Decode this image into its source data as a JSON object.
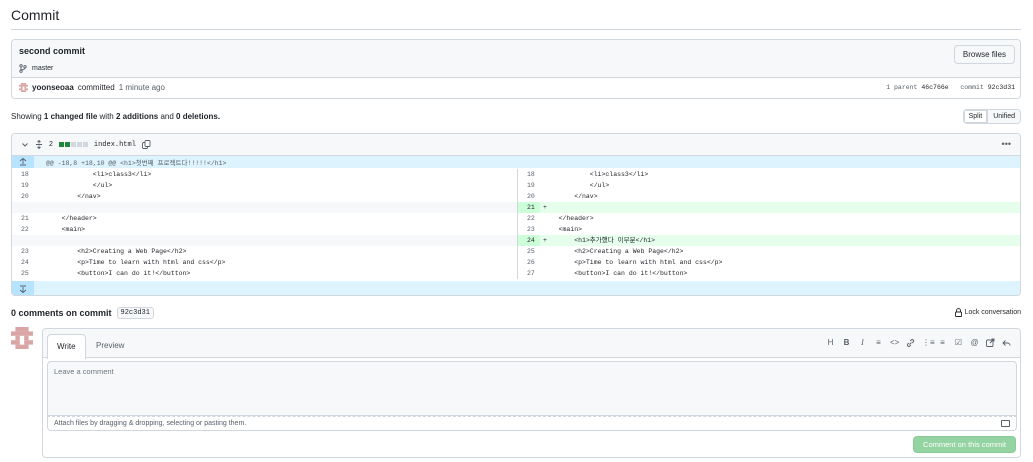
{
  "page": {
    "title": "Commit"
  },
  "commit": {
    "message": "second commit",
    "branch": "master",
    "browse_files_label": "Browse files",
    "author": "yoonseoaa",
    "action": "committed",
    "time": "1 minute ago",
    "parent_count": "1 parent",
    "parent_sha": "46c766e",
    "commit_label": "commit",
    "commit_sha": "92c3d31"
  },
  "summary": {
    "prefix": "Showing",
    "changed": "1 changed file",
    "with": "with",
    "additions": "2 additions",
    "and": "and",
    "deletions": "0 deletions."
  },
  "view_toggle": {
    "split": "Split",
    "unified": "Unified",
    "selected": "Split"
  },
  "diff": {
    "change_count": "2",
    "filename": "index.html",
    "hunk_header": "@@ -18,8 +18,10 @@ <h1>첫번째 프로젝트다!!!!!</h1>",
    "rows": [
      {
        "l_num": "18",
        "l_code": "            <li>class3</li>",
        "r_num": "18",
        "r_code": "            <li>class3</li>",
        "type": "ctx"
      },
      {
        "l_num": "19",
        "l_code": "            </ul>",
        "r_num": "19",
        "r_code": "            </ul>",
        "type": "ctx"
      },
      {
        "l_num": "20",
        "l_code": "        </nav>",
        "r_num": "20",
        "r_code": "        </nav>",
        "type": "ctx"
      },
      {
        "l_num": "",
        "l_code": "",
        "r_num": "21",
        "r_code": "+",
        "type": "add"
      },
      {
        "l_num": "21",
        "l_code": "    </header>",
        "r_num": "22",
        "r_code": "    </header>",
        "type": "ctx"
      },
      {
        "l_num": "22",
        "l_code": "    <main>",
        "r_num": "23",
        "r_code": "    <main>",
        "type": "ctx"
      },
      {
        "l_num": "",
        "l_code": "",
        "r_num": "24",
        "r_code": "+       <h1>추가했다 이부분</h1>",
        "type": "add"
      },
      {
        "l_num": "23",
        "l_code": "        <h2>Creating a Web Page</h2>",
        "r_num": "25",
        "r_code": "        <h2>Creating a Web Page</h2>",
        "type": "ctx"
      },
      {
        "l_num": "24",
        "l_code": "        <p>Time to learn with html and css</p>",
        "r_num": "26",
        "r_code": "        <p>Time to learn with html and css</p>",
        "type": "ctx"
      },
      {
        "l_num": "25",
        "l_code": "        <button>I can do it!</button>",
        "r_num": "27",
        "r_code": "        <button>I can do it!</button>",
        "type": "ctx"
      }
    ]
  },
  "comments": {
    "title": "0 comments on commit",
    "sha": "92c3d31",
    "lock_label": "Lock conversation",
    "write_tab": "Write",
    "preview_tab": "Preview",
    "placeholder": "Leave a comment",
    "attach_hint": "Attach files by dragging & dropping, selecting or pasting them.",
    "submit_label": "Comment on this commit"
  },
  "toolbar_icons": [
    "heading-icon",
    "bold-icon",
    "italic-icon",
    "quote-icon",
    "code-icon",
    "link-icon",
    "unordered-list-icon",
    "ordered-list-icon",
    "task-list-icon",
    "mention-icon",
    "reference-icon",
    "reply-icon"
  ],
  "colors": {
    "add_bg": "#e6ffec",
    "add_num_bg": "#ccffd8",
    "hunk_bg": "#ddf4ff",
    "submit_bg": "#94d3a2",
    "border": "#d0d7de"
  }
}
